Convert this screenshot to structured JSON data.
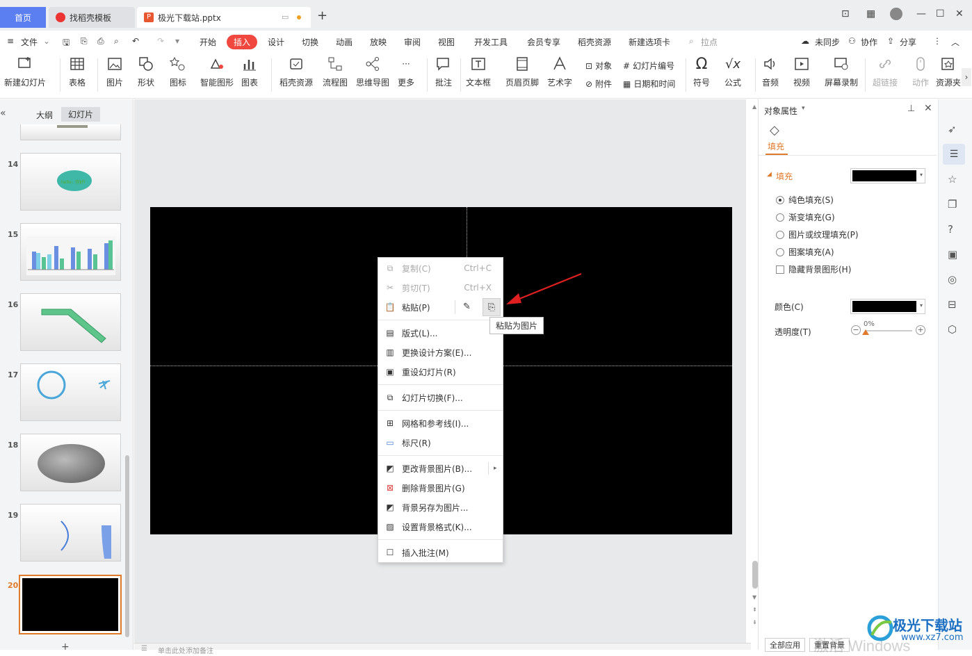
{
  "tabs": {
    "home": "首页",
    "template": "找稻壳模板",
    "doc": "极光下载站.pptx",
    "new_tab": "+"
  },
  "menu": [
    "文件",
    "开始",
    "插入",
    "设计",
    "切换",
    "动画",
    "放映",
    "审阅",
    "视图",
    "开发工具",
    "会员专享",
    "稻壳资源",
    "新建选项卡"
  ],
  "menu_active": "插入",
  "search": "拉点",
  "header_right": {
    "sync": "未同步",
    "collab": "协作",
    "share": "分享"
  },
  "ribbon": {
    "new_slide": "新建幻灯片",
    "table": "表格",
    "picture": "图片",
    "shape": "形状",
    "icon": "图标",
    "smart": "智能图形",
    "chart": "图表",
    "daoke": "稻壳资源",
    "flow": "流程图",
    "mind": "思维导图",
    "more": "更多",
    "comment": "批注",
    "textbox": "文本框",
    "header_footer": "页眉页脚",
    "art": "艺术字",
    "object": "对象",
    "attachment": "附件",
    "slide_no": "幻灯片编号",
    "datetime": "日期和时间",
    "symbol": "符号",
    "formula": "公式",
    "audio": "音频",
    "video": "视频",
    "screen_rec": "屏幕录制",
    "hyperlink": "超链接",
    "action": "动作",
    "resource": "资源夹"
  },
  "left_panel": {
    "tab_outline": "大纲",
    "tab_slides": "幻灯片",
    "slides": [
      {
        "num": "14"
      },
      {
        "num": "15"
      },
      {
        "num": "16"
      },
      {
        "num": "17"
      },
      {
        "num": "18"
      },
      {
        "num": "19"
      },
      {
        "num": "20"
      }
    ],
    "slide14_text": "hello，你好!"
  },
  "context_menu": {
    "copy": "复制(C)",
    "copy_sc": "Ctrl+C",
    "cut": "剪切(T)",
    "cut_sc": "Ctrl+X",
    "paste": "粘贴(P)",
    "layout": "版式(L)...",
    "design": "更换设计方案(E)...",
    "reset": "重设幻灯片(R)",
    "transition": "幻灯片切换(F)...",
    "grid": "网格和参考线(I)...",
    "ruler": "标尺(R)",
    "change_bg": "更改背景图片(B)...",
    "delete_bg": "删除背景图片(G)",
    "save_bg": "背景另存为图片...",
    "bg_format": "设置背景格式(K)...",
    "insert_comment": "插入批注(M)"
  },
  "tooltip": "粘贴为图片",
  "right_panel": {
    "title": "对象属性",
    "tab_fill": "填充",
    "fill_section": "填充",
    "solid": "纯色填充(S)",
    "gradient": "渐变填充(G)",
    "picture": "图片或纹理填充(P)",
    "pattern": "图案填充(A)",
    "hide_bg": "隐藏背景图形(H)",
    "color_label": "颜色(C)",
    "transparency_label": "透明度(T)",
    "transparency_value": "0%",
    "apply_all": "全部应用",
    "reset_bg": "重置背景"
  },
  "notes_placeholder": "单击此处添加备注",
  "watermark": {
    "activate": "激活 Windows",
    "brand": "极光下载站",
    "url": "www.xz7.com"
  },
  "colors": {
    "accent": "#f0483e",
    "home_tab": "#5b7ef0",
    "active_orange": "#e07a2b"
  }
}
